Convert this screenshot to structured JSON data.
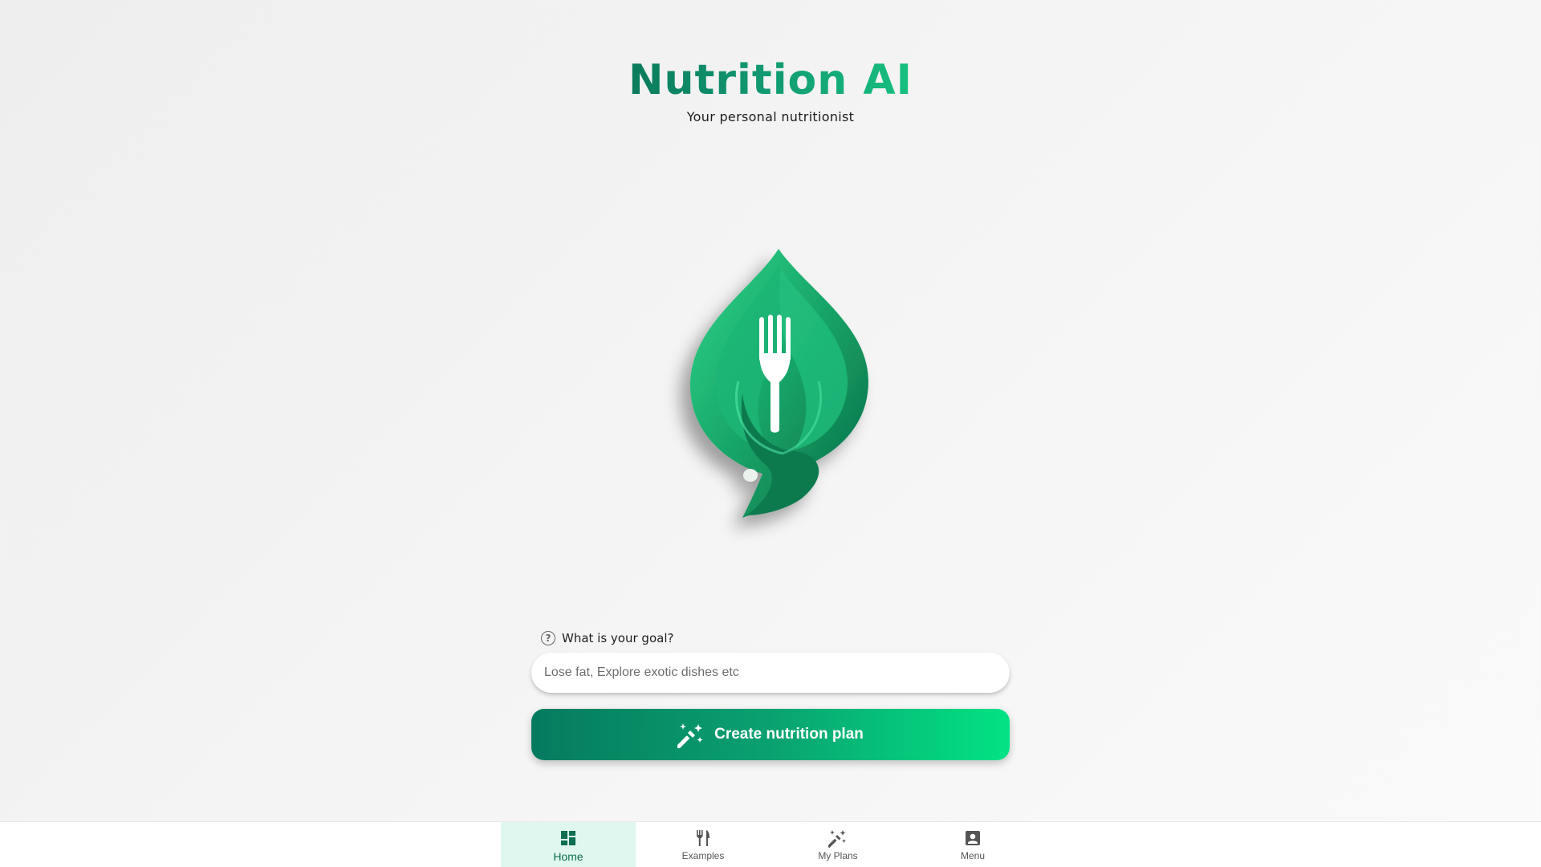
{
  "header": {
    "title": "Nutrition AI",
    "subtitle": "Your personal nutritionist"
  },
  "logo": {
    "icon": "leaf-fork-logo"
  },
  "form": {
    "goal_label": "What is your goal?",
    "goal_help_icon": "help-circle-icon",
    "goal_placeholder": "Lose fat, Explore exotic dishes etc",
    "goal_value": "",
    "create_button_label": "Create nutrition plan",
    "create_button_icon": "magic-wand-icon"
  },
  "nav": {
    "active": "Home",
    "items": [
      {
        "label": "Home",
        "icon": "dashboard-icon"
      },
      {
        "label": "Examples",
        "icon": "fork-knife-icon"
      },
      {
        "label": "My Plans",
        "icon": "magic-wand-icon"
      },
      {
        "label": "Menu",
        "icon": "account-box-icon"
      }
    ]
  },
  "colors": {
    "brand_dark": "#0b7a5c",
    "brand_light": "#02e384",
    "nav_active_bg": "#dff7ee"
  }
}
